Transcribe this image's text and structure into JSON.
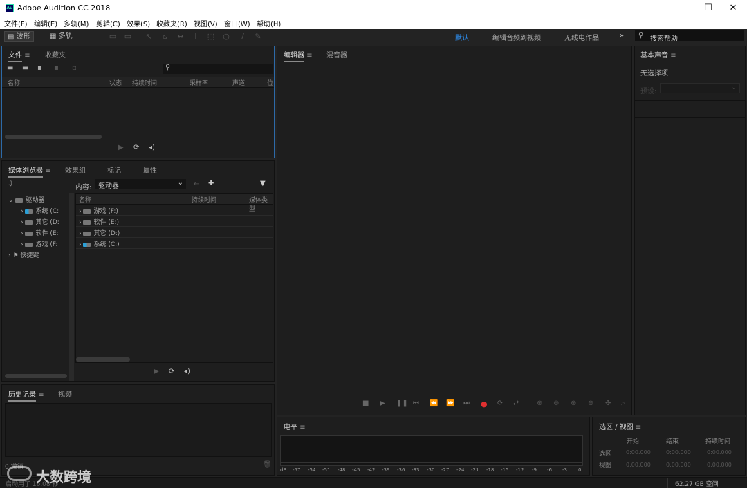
{
  "app": {
    "title": "Adobe Audition CC 2018",
    "icon_text": "Au"
  },
  "window_controls": {
    "minimize": "—",
    "maximize": "☐",
    "close": "✕"
  },
  "menu": [
    "文件(F)",
    "编辑(E)",
    "多轨(M)",
    "剪辑(C)",
    "效果(S)",
    "收藏夹(R)",
    "视图(V)",
    "窗口(W)",
    "帮助(H)"
  ],
  "toolbar": {
    "waveform": "波形",
    "multitrack": "多轨"
  },
  "workspaces": [
    "默认",
    "编辑音频到视频",
    "无线电作品"
  ],
  "search_help": {
    "placeholder": "搜索帮助"
  },
  "files_panel": {
    "tabs": [
      "文件",
      "收藏夹"
    ],
    "columns": [
      "名称",
      "状态",
      "持续时间",
      "采样率",
      "声道",
      "位"
    ]
  },
  "media_panel": {
    "tabs": [
      "媒体浏览器",
      "效果组",
      "标记",
      "属性"
    ],
    "content_label": "内容:",
    "content_value": "驱动器",
    "tree_root": "驱动器",
    "tree_drives": [
      "系统 (C:",
      "其它 (D:",
      "软件 (E:",
      "游戏 (F:"
    ],
    "tree_shortcut": "快捷键",
    "columns": [
      "名称",
      "持续时间",
      "媒体类型"
    ],
    "list": [
      "游戏 (F:)",
      "软件 (E:)",
      "其它 (D:)",
      "系统 (C:)"
    ]
  },
  "history_panel": {
    "tabs": [
      "历史记录",
      "视频"
    ],
    "undo_text": "0 撤销",
    "status_text": "启动用了 16.08 秒"
  },
  "editor": {
    "tabs": [
      "编辑器",
      "混音器"
    ]
  },
  "essential_sound": {
    "title": "基本声音",
    "no_selection": "无选择项",
    "preset_label": "预设:"
  },
  "levels": {
    "title": "电平",
    "ticks": [
      "dB",
      "-57",
      "-54",
      "-51",
      "-48",
      "-45",
      "-42",
      "-39",
      "-36",
      "-33",
      "-30",
      "-27",
      "-24",
      "-21",
      "-18",
      "-15",
      "-12",
      "-9",
      "-6",
      "-3",
      "0"
    ]
  },
  "selection_view": {
    "title": "选区 / 视图",
    "headers": [
      "开始",
      "结束",
      "持续时间"
    ],
    "rows": [
      {
        "label": "选区",
        "values": [
          "0:00.000",
          "0:00.000",
          "0:00.000"
        ]
      },
      {
        "label": "视图",
        "values": [
          "0:00.000",
          "0:00.000",
          "0:00.000"
        ]
      }
    ]
  },
  "status": {
    "disk_space": "62.27 GB 空间"
  },
  "watermark": {
    "text": "大数跨境"
  },
  "colors": {
    "accent": "#2d8ceb",
    "record": "#e03030",
    "panel_bg": "#1e1e1e",
    "app_bg": "#232323"
  }
}
